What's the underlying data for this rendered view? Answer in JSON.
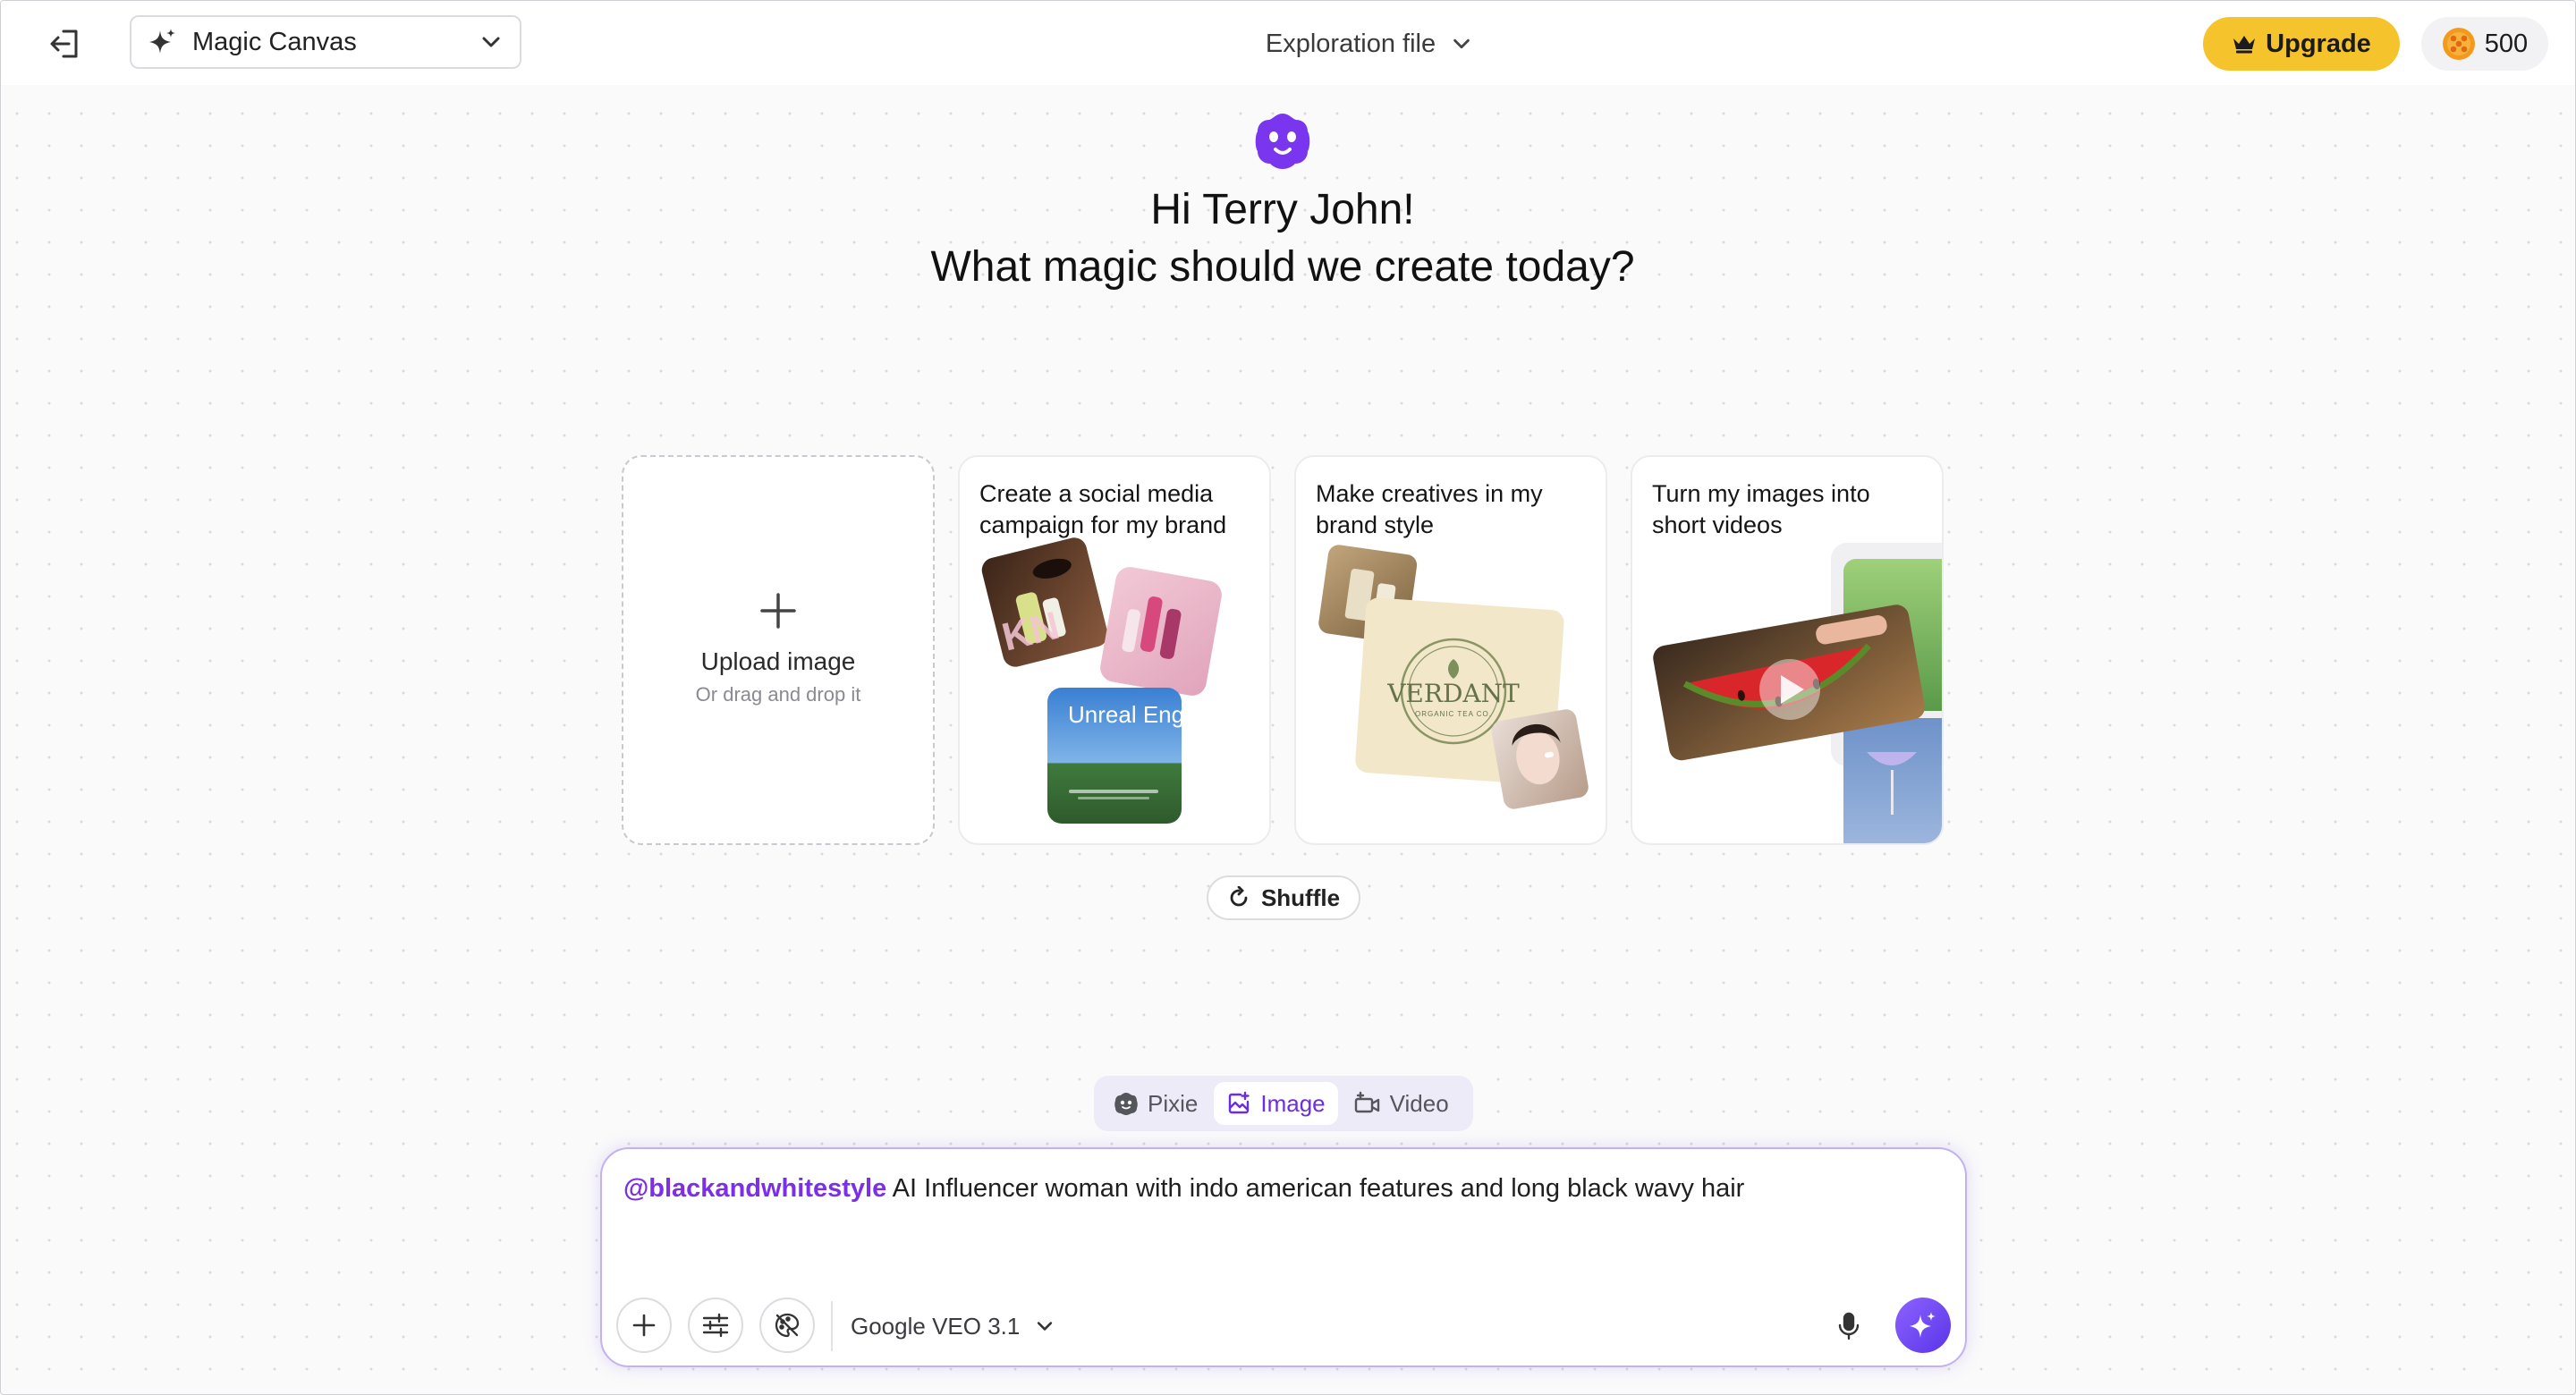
{
  "header": {
    "app_name": "Magic Canvas",
    "file_name": "Exploration file",
    "upgrade_label": "Upgrade",
    "credits": "500"
  },
  "greeting": {
    "line1": "Hi Terry John!",
    "line2": "What magic should we create today?"
  },
  "upload": {
    "label": "Upload image",
    "sublabel": "Or drag and drop it"
  },
  "cards": [
    {
      "title": "Create a social media campaign for my brand",
      "image_text": "Unreal Engine"
    },
    {
      "title": "Make creatives in my brand style",
      "image_text": "VERDANT",
      "image_subtext": "ORGANIC TEA CO."
    },
    {
      "title": "Turn my images into short videos"
    }
  ],
  "shuffle_label": "Shuffle",
  "modes": {
    "items": [
      {
        "label": "Pixie",
        "icon": "pixie-icon"
      },
      {
        "label": "Image",
        "icon": "image-icon"
      },
      {
        "label": "Video",
        "icon": "video-icon"
      }
    ],
    "active": "Image"
  },
  "prompt": {
    "mention": "@blackandwhitestyle",
    "text": " AI Influencer woman with indo american features and long black wavy hair",
    "model": "Google VEO 3.1"
  },
  "colors": {
    "accent": "#7b2fe6",
    "upgrade": "#f5c42c",
    "mascot": "#7a35ef"
  }
}
